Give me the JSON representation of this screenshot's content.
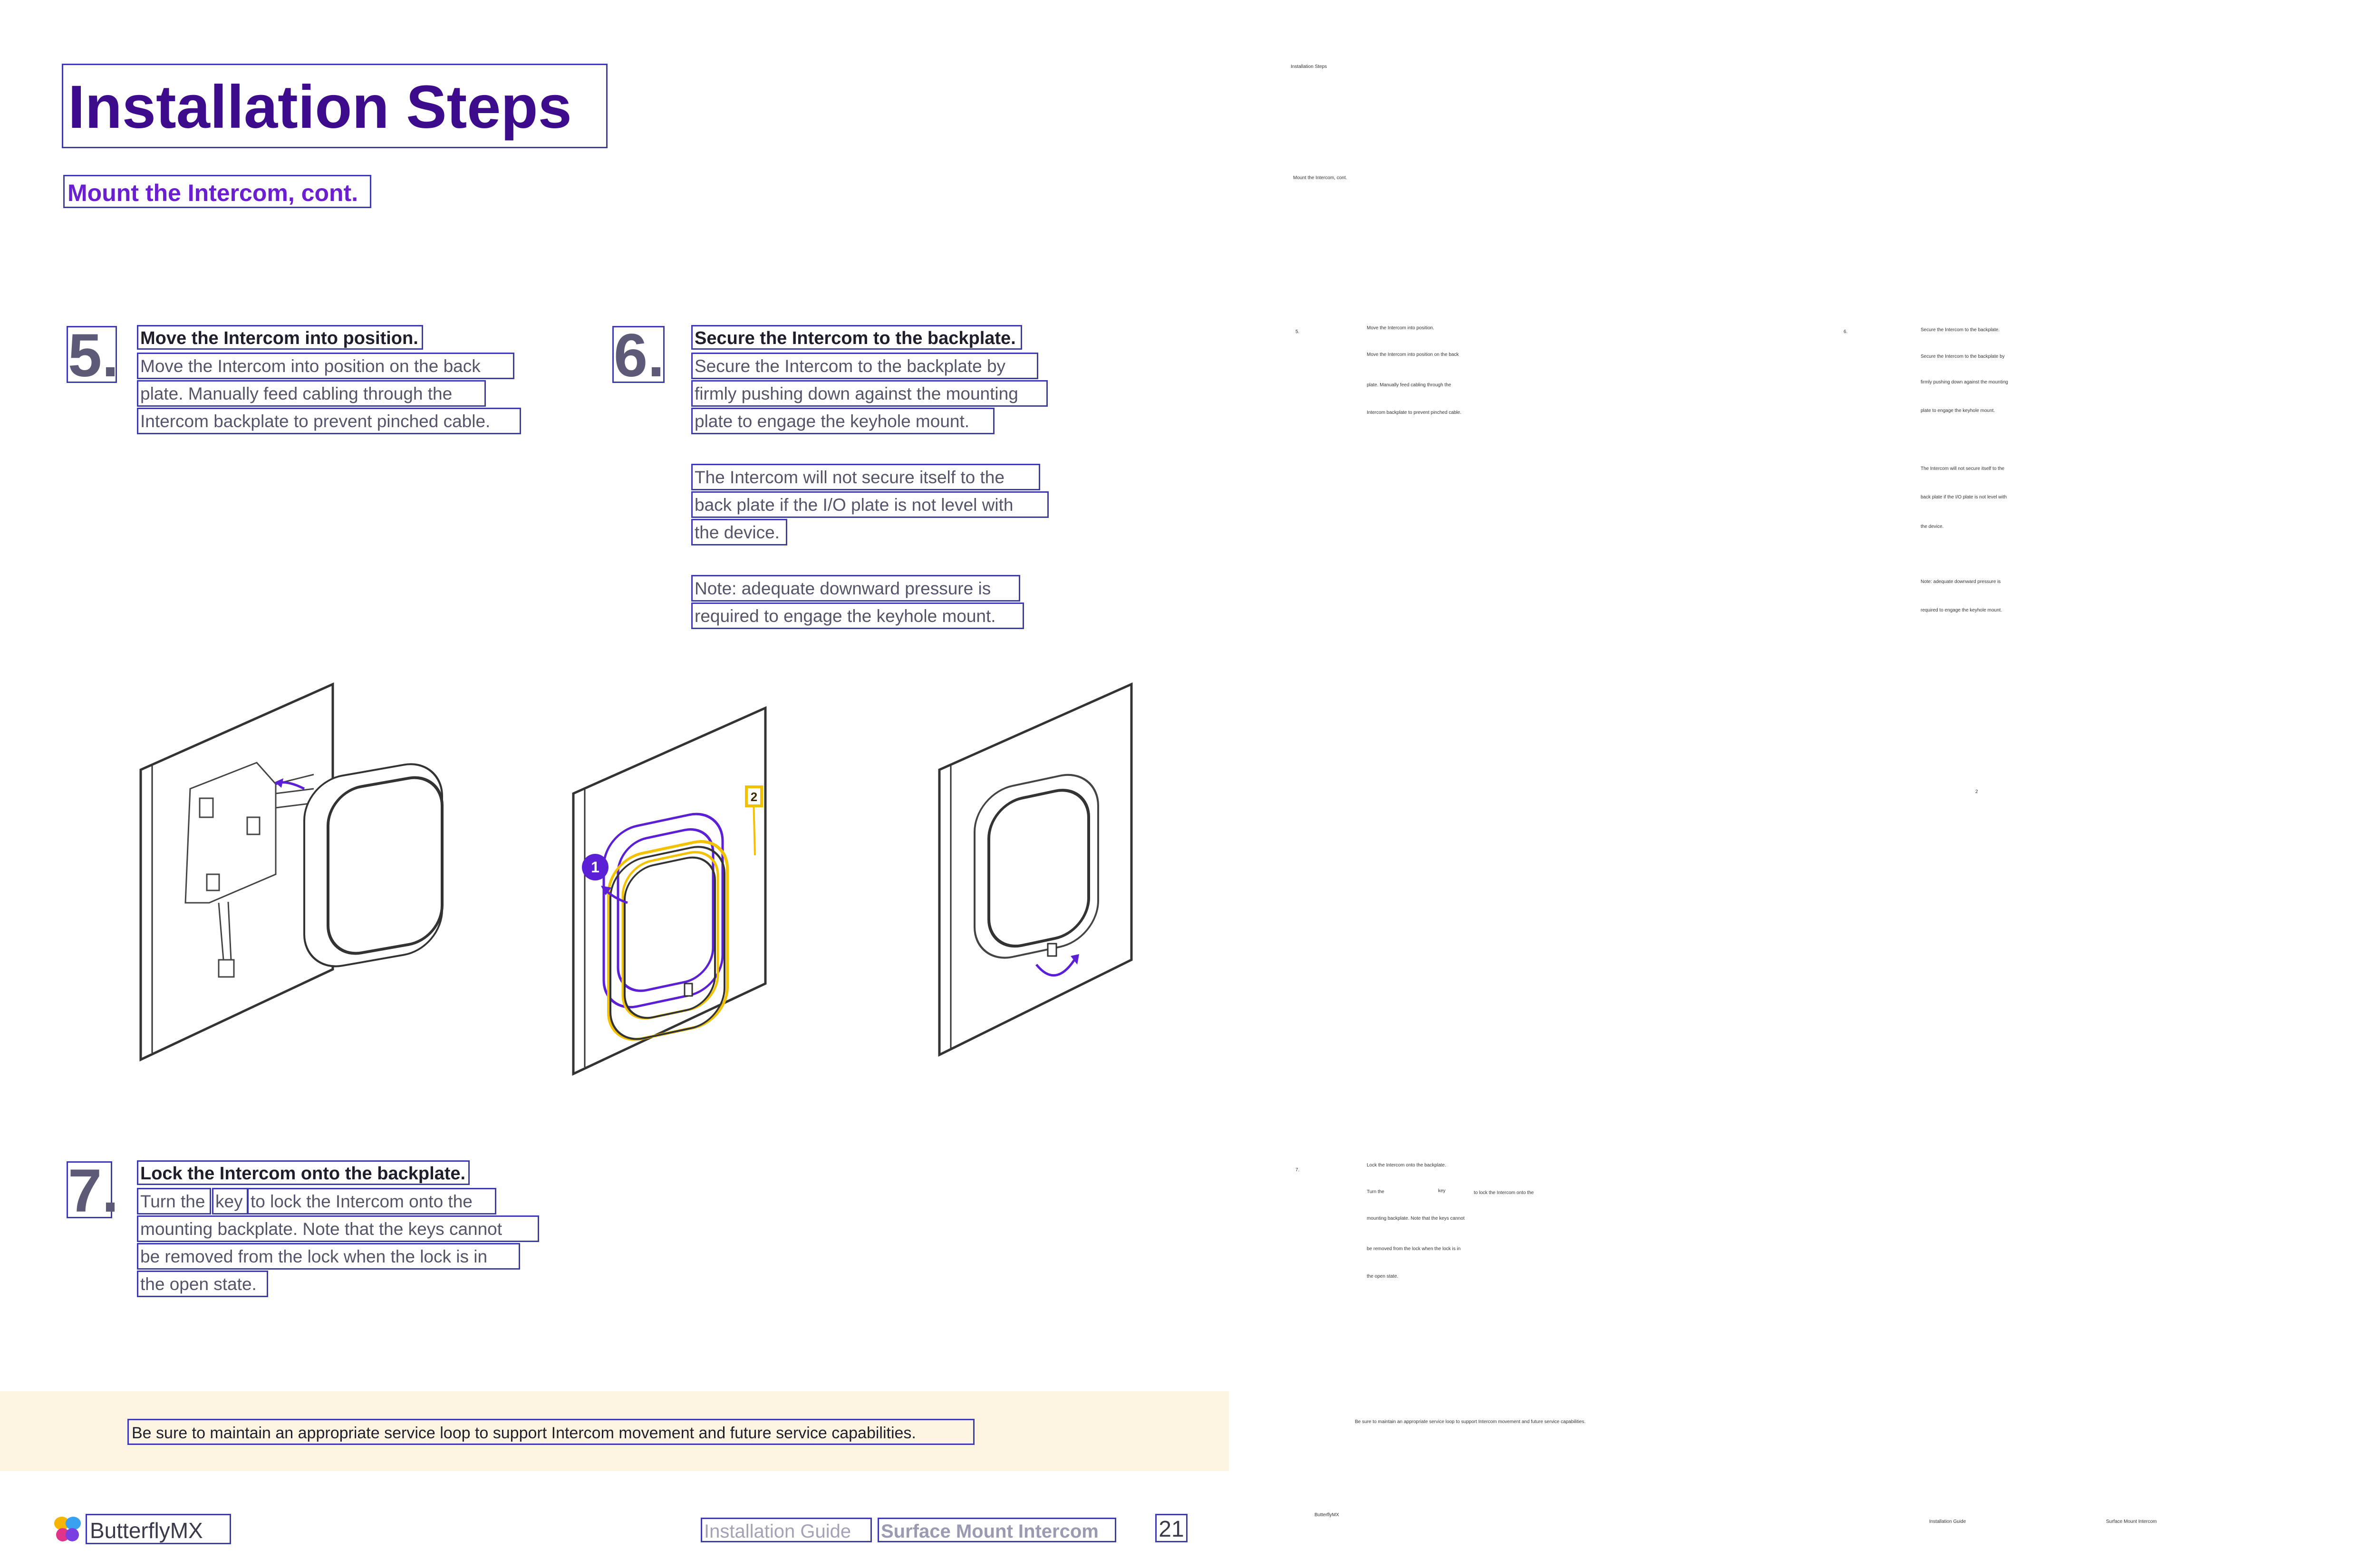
{
  "title": "Installation Steps",
  "subtitle": "Mount the Intercom, cont.",
  "step5": {
    "number": "5.",
    "heading": "Move the Intercom into position.",
    "lines": [
      "Move the Intercom into position on the back",
      "plate. Manually feed cabling through the",
      "Intercom backplate to prevent pinched cable."
    ]
  },
  "step6": {
    "number": "6.",
    "heading": "Secure the Intercom to the backplate.",
    "lines": [
      "Secure the Intercom to the backplate by",
      "firmly pushing down against the mounting",
      "plate to engage the keyhole mount."
    ],
    "warning_lines": [
      "The Intercom will not secure itself to the",
      "back plate if the I/O plate is not level with",
      "the device."
    ],
    "note_lines": [
      "Note: adequate downward pressure is",
      "required to engage the keyhole mount."
    ]
  },
  "step7": {
    "number": "7.",
    "heading": "Lock the Intercom onto the backplate.",
    "line1_prefix": "Turn the",
    "line1_key": "key",
    "line1_suffix": "to lock the Intercom onto the",
    "lines": [
      "mounting backplate. Note that the keys cannot",
      "be removed from the lock when the lock is in",
      "the open state."
    ]
  },
  "callouts": [
    "1",
    "2"
  ],
  "banner": "Be sure to maintain an appropriate service loop to support Intercom movement and future service capabilities.",
  "footer": {
    "brand": "ButterflyMX",
    "guide": "Installation Guide",
    "product": "Surface Mount Intercom",
    "page": "21"
  },
  "colors": {
    "title": "#3d0c8c",
    "subtitle": "#6b1fd1",
    "annotation_box": "#3d3bb0",
    "accent_purple": "#5b1fd6",
    "accent_yellow": "#f2c200",
    "banner_bg": "#fdf5e1"
  },
  "text_layer": {
    "title": "Installation Steps",
    "subtitle": "Mount the Intercom, cont.",
    "step5_num": "5.",
    "step5_heading": "Move the Intercom into position.",
    "step5_lines": [
      "Move the Intercom into position on the back",
      "plate. Manually feed cabling through the",
      "Intercom backplate to prevent pinched cable."
    ],
    "step6_num": "6.",
    "step6_heading": "Secure the Intercom to the backplate.",
    "step6_lines": [
      "Secure the Intercom to the backplate by",
      "firmly pushing down against the mounting",
      "plate to engage the keyhole mount."
    ],
    "step6_warning": [
      "The Intercom will not secure itself to the",
      "back plate if the I/O plate is not level with",
      "the device."
    ],
    "step6_note": [
      "Note: adequate downward pressure is",
      "required to engage the keyhole mount."
    ],
    "callout_2": "2",
    "step7_num": "7.",
    "step7_heading": "Lock the Intercom onto the backplate.",
    "step7_prefix": "Turn the",
    "step7_key": "key",
    "step7_suffix": "to lock the Intercom onto the",
    "step7_lines": [
      "mounting backplate. Note that the keys cannot",
      "be removed from the lock when the lock is in",
      "the open state."
    ],
    "banner": "Be sure to maintain an appropriate service loop to support Intercom movement and future service capabilities.",
    "brand": "ButterflyMX",
    "guide": "Installation Guide",
    "product": "Surface Mount Intercom",
    "page": "21"
  }
}
